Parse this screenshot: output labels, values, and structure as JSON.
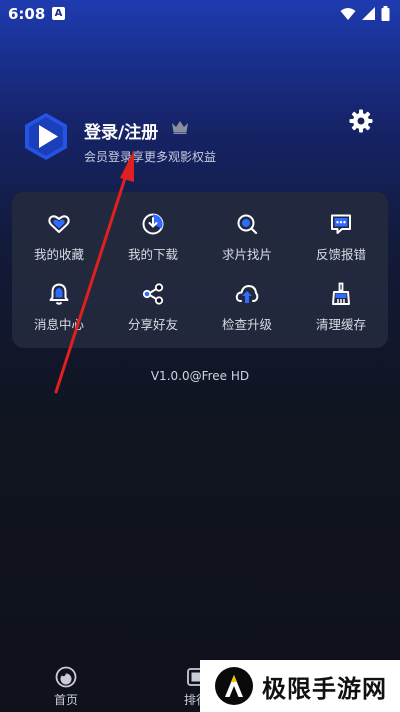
{
  "status_bar": {
    "time": "6:08",
    "notification_glyph": "A",
    "icons": [
      "wifi-icon",
      "signal-icon",
      "battery-icon"
    ]
  },
  "profile": {
    "title": "登录/注册",
    "subtitle": "会员登录享更多观影权益",
    "icons": [
      "app-logo-icon",
      "crown-icon",
      "settings-icon"
    ]
  },
  "menu": {
    "items": [
      {
        "label": "我的收藏",
        "icon": "heart-icon"
      },
      {
        "label": "我的下载",
        "icon": "download-icon"
      },
      {
        "label": "求片找片",
        "icon": "search-film-icon"
      },
      {
        "label": "反馈报错",
        "icon": "feedback-icon"
      },
      {
        "label": "消息中心",
        "icon": "bell-icon"
      },
      {
        "label": "分享好友",
        "icon": "share-icon"
      },
      {
        "label": "检查升级",
        "icon": "upgrade-icon"
      },
      {
        "label": "清理缓存",
        "icon": "broom-icon"
      }
    ]
  },
  "version": "V1.0.0@Free HD",
  "bottom_nav": {
    "home_label": "首页",
    "rank_label": "排行"
  },
  "watermark": {
    "text": "极限手游网"
  },
  "colors": {
    "accent": "#2f6bff",
    "annotation": "#e0201e",
    "card": "#242a3e"
  }
}
